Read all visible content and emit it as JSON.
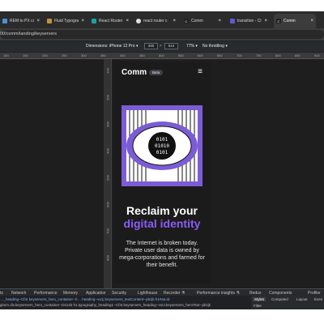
{
  "browser": {
    "tabs": [
      {
        "label": "REM to PX co",
        "favicon_color": "#4a90d9"
      },
      {
        "label": "Fluid Typogra",
        "favicon_color": "#c28f3c"
      },
      {
        "label": "React Router",
        "favicon_color": "#1aa39a"
      },
      {
        "label": "react router c",
        "favicon_color": "#e0e0e0"
      },
      {
        "label": "Comm",
        "favicon_color": "#202124"
      },
      {
        "label": "transition - Cl",
        "favicon_color": "#5b5bd6"
      },
      {
        "label": "Comm",
        "favicon_color": "#202124"
      }
    ],
    "address": "00/comm/landing/keyservers"
  },
  "device_toolbar": {
    "dimensions_label": "Dimensions: iPhone 12 Pro",
    "width": "390",
    "height": "844",
    "zoom": "77%",
    "throttling": "No throttling"
  },
  "rulers": {
    "horizontal": [
      "100",
      "150",
      "200",
      "250",
      "300",
      "350",
      "400",
      "450",
      "500",
      "550",
      "600",
      "650",
      "700",
      "750",
      "800",
      "850",
      "900"
    ],
    "vertical": [
      "100",
      "200",
      "300",
      "400",
      "500",
      "600",
      "700",
      "800"
    ]
  },
  "page": {
    "brand": "Comm",
    "badge": "Beta",
    "menu_glyph": "≡",
    "eye_text_1": "0101",
    "eye_text_2": "01010",
    "eye_text_3": "0101",
    "headline_1": "Reclaim your",
    "headline_2": "digital identity",
    "body": "The Internet is broken today. Private user data is owned by mega-corporations and farmed for their benefit.",
    "colors": {
      "accent": "#8b5cf6",
      "art_bg": "#7c5cd6"
    }
  },
  "devtools": {
    "tabs": [
      "ts",
      "Network",
      "Performance",
      "Memory",
      "Application",
      "Security",
      "Lighthouse",
      "Recorder ⚗",
      "Performance insights ⚗",
      "Redux",
      "Components",
      "Profiler"
    ],
    "crumb_1": "…_heading--Cf4r keyservers_hero_container--h…   heading--vu1j keyservers_textContent--pbzjk   h1#aa-id",
    "crumb_2": "gimm   div.keyservers_hero_container--Ds14b   h1.typography_heading1--Cf4r.keyservers_heading--vvIJ.keyservers_heroText--pbzjk",
    "side_tabs": [
      "Styles",
      "Computed",
      "Layout",
      "Even"
    ],
    "filter": "Filter"
  }
}
